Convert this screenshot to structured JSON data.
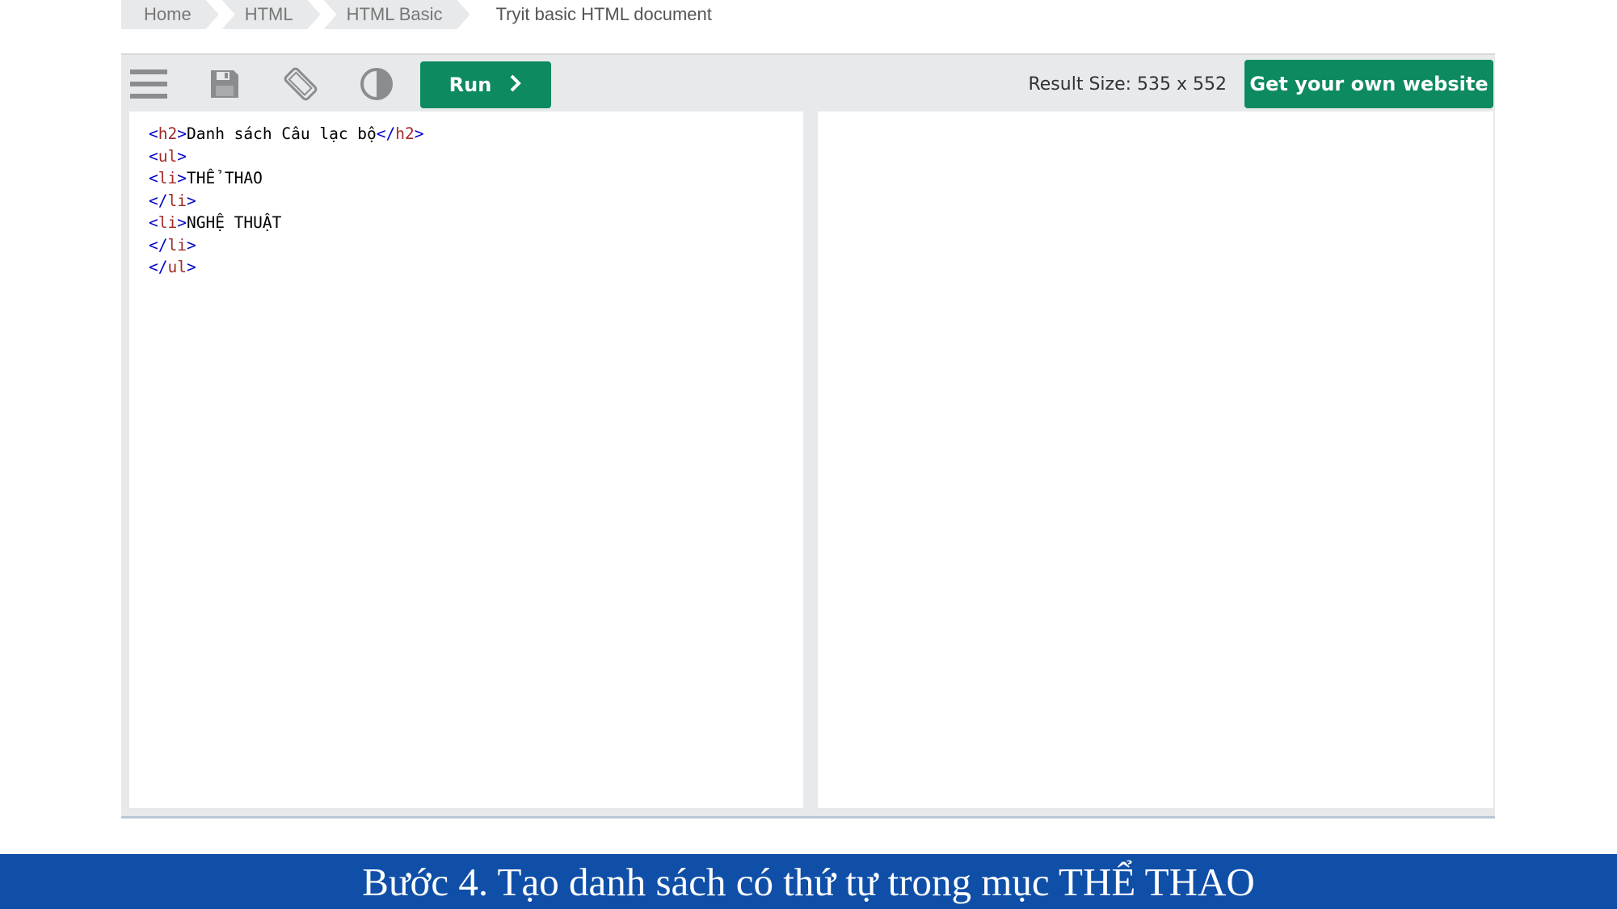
{
  "breadcrumb": {
    "items": [
      "Home",
      "HTML",
      "HTML Basic",
      "Tryit basic HTML document"
    ]
  },
  "toolbar": {
    "menu_icon": "hamburger-menu-icon",
    "save_icon": "floppy-disk-save-icon",
    "rotate_icon": "rotate-layout-icon",
    "theme_icon": "contrast-theme-icon",
    "run_label": "Run",
    "result_size": "Result Size: 535 x 552",
    "own_website_label": "Get your own website"
  },
  "editor": {
    "lines": [
      {
        "open": "<",
        "tag": "h2",
        "close": ">",
        "text": "Danh sách Câu lạc bộ",
        "end_open": "</",
        "end_tag": "h2",
        "end_close": ">"
      },
      {
        "open": "<",
        "tag": "ul",
        "close": ">"
      },
      {
        "open": "<",
        "tag": "li",
        "close": ">",
        "text": "THỂ THAO"
      },
      {
        "open": "</",
        "tag": "li",
        "close": ">"
      },
      {
        "open": "<",
        "tag": "li",
        "close": ">",
        "text": "NGHỆ THUẬT"
      },
      {
        "open": "</",
        "tag": "li",
        "close": ">"
      },
      {
        "open": "</",
        "tag": "ul",
        "close": ">"
      }
    ]
  },
  "caption": "Bước 4. Tạo danh sách có thứ tự trong mục THỂ THAO",
  "colors": {
    "run_button": "#0d8a5f",
    "toolbar_bg": "#e7e9eb",
    "caption_bg": "#0f4fa8",
    "tag_color": "#a52a2a",
    "bracket_color": "#0000cd"
  }
}
